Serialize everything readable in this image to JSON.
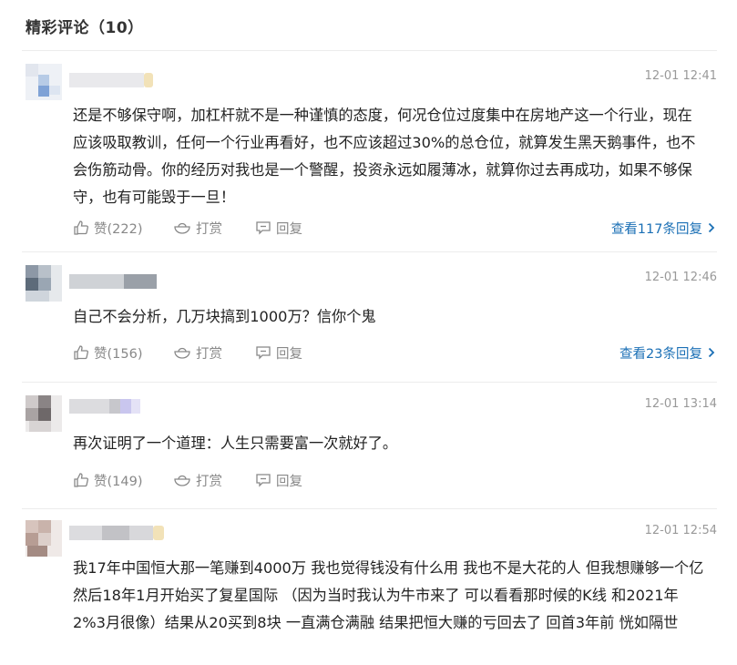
{
  "header": {
    "title": "精彩评论（10）"
  },
  "labels": {
    "like_prefix": "赞",
    "tip": "打赏",
    "reply": "回复"
  },
  "comments": [
    {
      "time": "12-01 12:41",
      "text": "还是不够保守啊，加杠杆就不是一种谨慎的态度，何况仓位过度集中在房地产这一个行业，现在应该吸取教训，任何一个行业再看好，也不应该超过30%的总仓位，就算发生黑天鹅事件，也不会伤筋动骨。你的经历对我也是一个警醒，投资永远如履薄冰，就算你过去再成功，如果不够保守，也有可能毁于一旦！",
      "likes": "赞(222)",
      "more": "查看117条回复"
    },
    {
      "time": "12-01 12:46",
      "text": "自己不会分析，几万块搞到1000万？信你个鬼",
      "likes": "赞(156)",
      "more": "查看23条回复"
    },
    {
      "time": "12-01 13:14",
      "text": "再次证明了一个道理：人生只需要富一次就好了。",
      "likes": "赞(149)",
      "more": ""
    },
    {
      "time": "12-01 12:54",
      "text": "我17年中国恒大那一笔赚到4000万 我也觉得钱没有什么用 我也不是大花的人 但我想赚够一个亿 然后18年1月开始买了复星国际 （因为当时我认为牛市来了 可以看看那时候的K线 和2021年2%3月很像）结果从20买到8块 一直满仓满融 结果把恒大赚的亏回去了 回首3年前 恍如隔世",
      "likes": "",
      "more": ""
    }
  ],
  "colors": {
    "link": "#1a6fb5",
    "muted": "#888888",
    "time": "#999999"
  },
  "icons": [
    "thumbs-up-icon",
    "tip-bowl-icon",
    "reply-bubble-icon",
    "chevron-right-icon"
  ]
}
